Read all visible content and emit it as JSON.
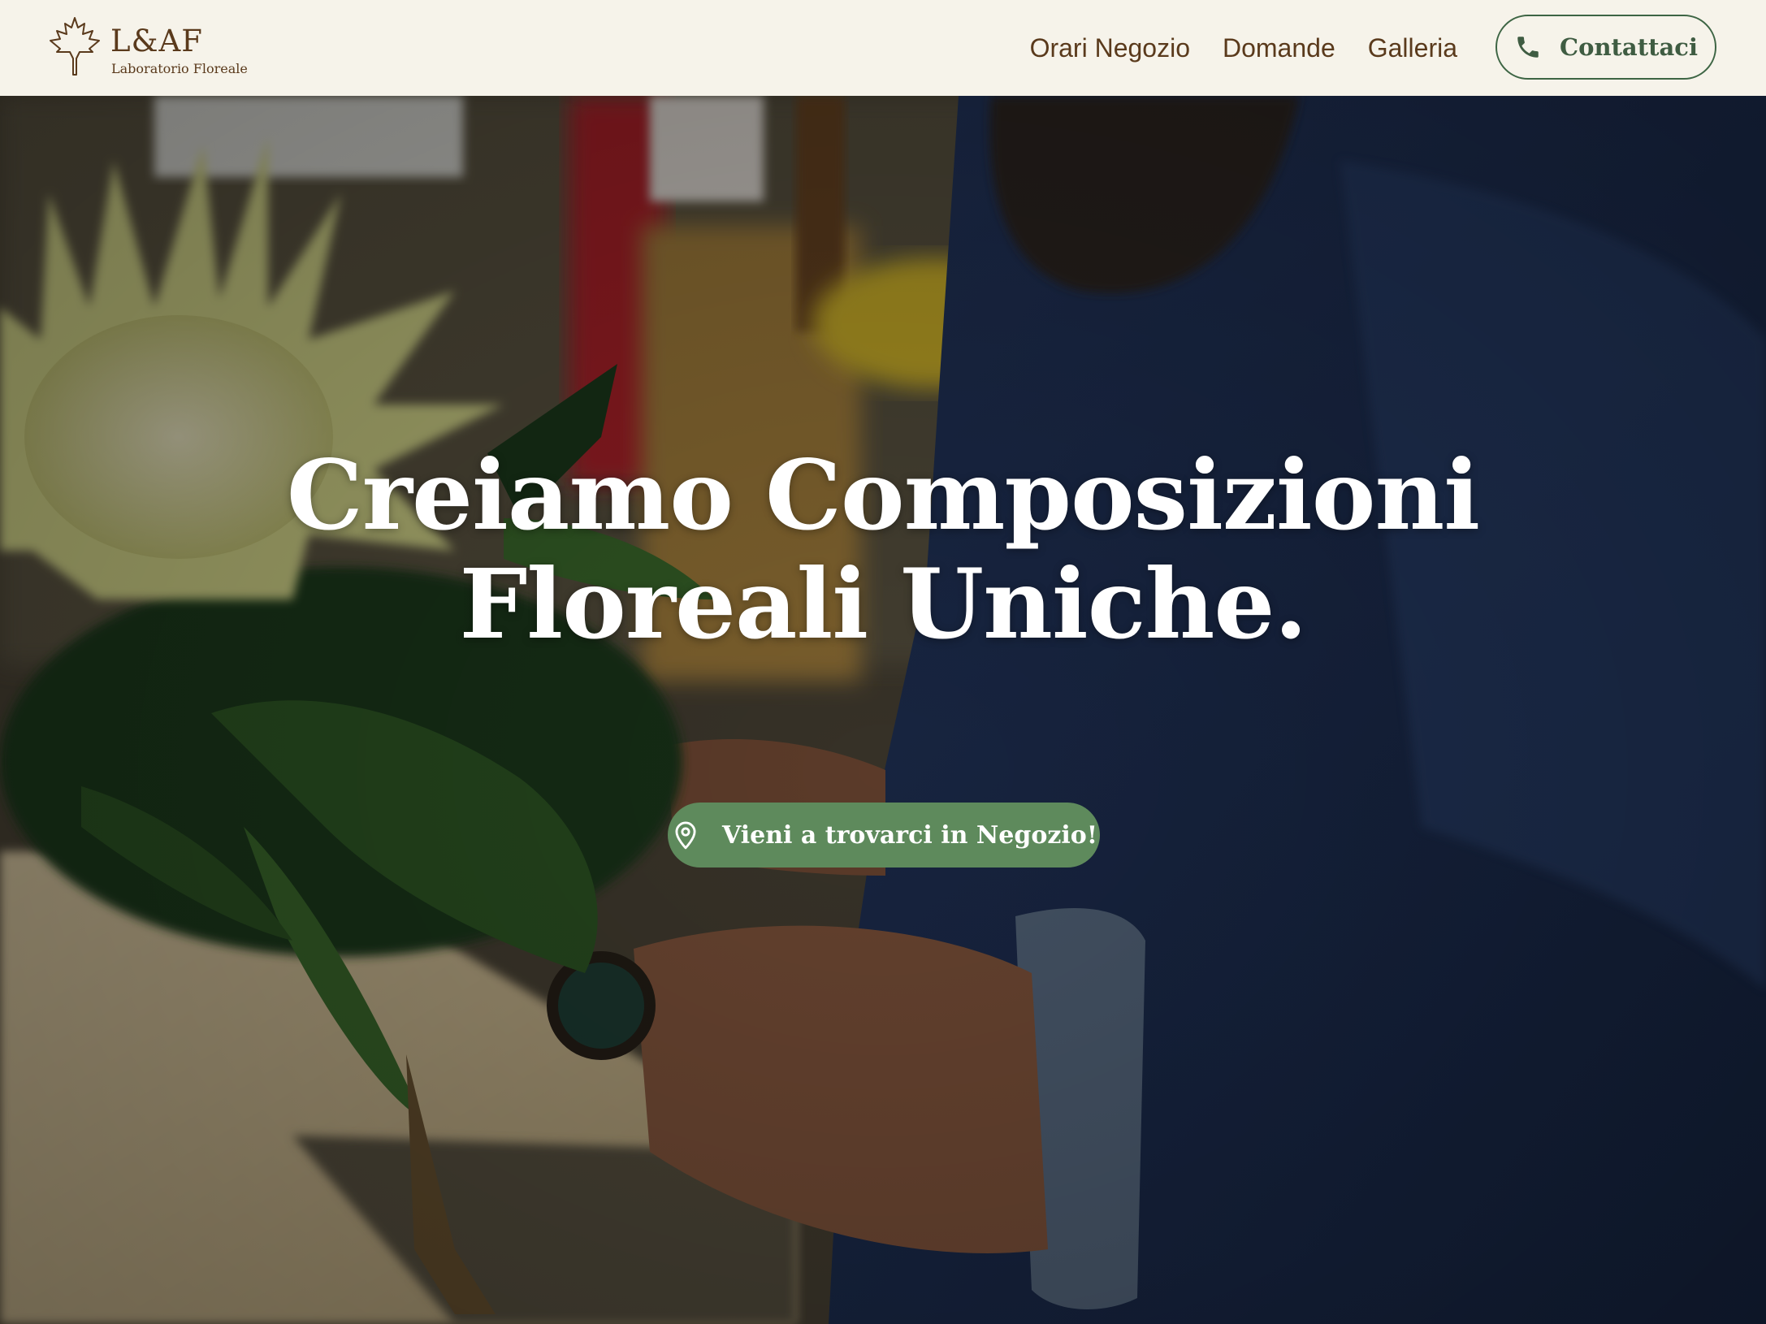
{
  "header": {
    "logo_name": "L&AF",
    "logo_sub": "Laboratorio Floreale",
    "nav": [
      {
        "label": "Orari Negozio"
      },
      {
        "label": "Domande"
      },
      {
        "label": "Galleria"
      }
    ],
    "contact_label": "Contattaci",
    "contact_icon": "phone-icon"
  },
  "hero": {
    "title_line1": "Creiamo Composizioni",
    "title_line2": "Floreali Uniche.",
    "cta_label": "Vieni a trovarci in Negozio!",
    "cta_icon": "map-pin-icon",
    "photo": "florist-holding-bouquet"
  },
  "colors": {
    "header_bg": "#f6f3ea",
    "brand_brown": "#5a3a1c",
    "brand_green": "#3d6544",
    "cta_green": "#5e8a5c"
  }
}
